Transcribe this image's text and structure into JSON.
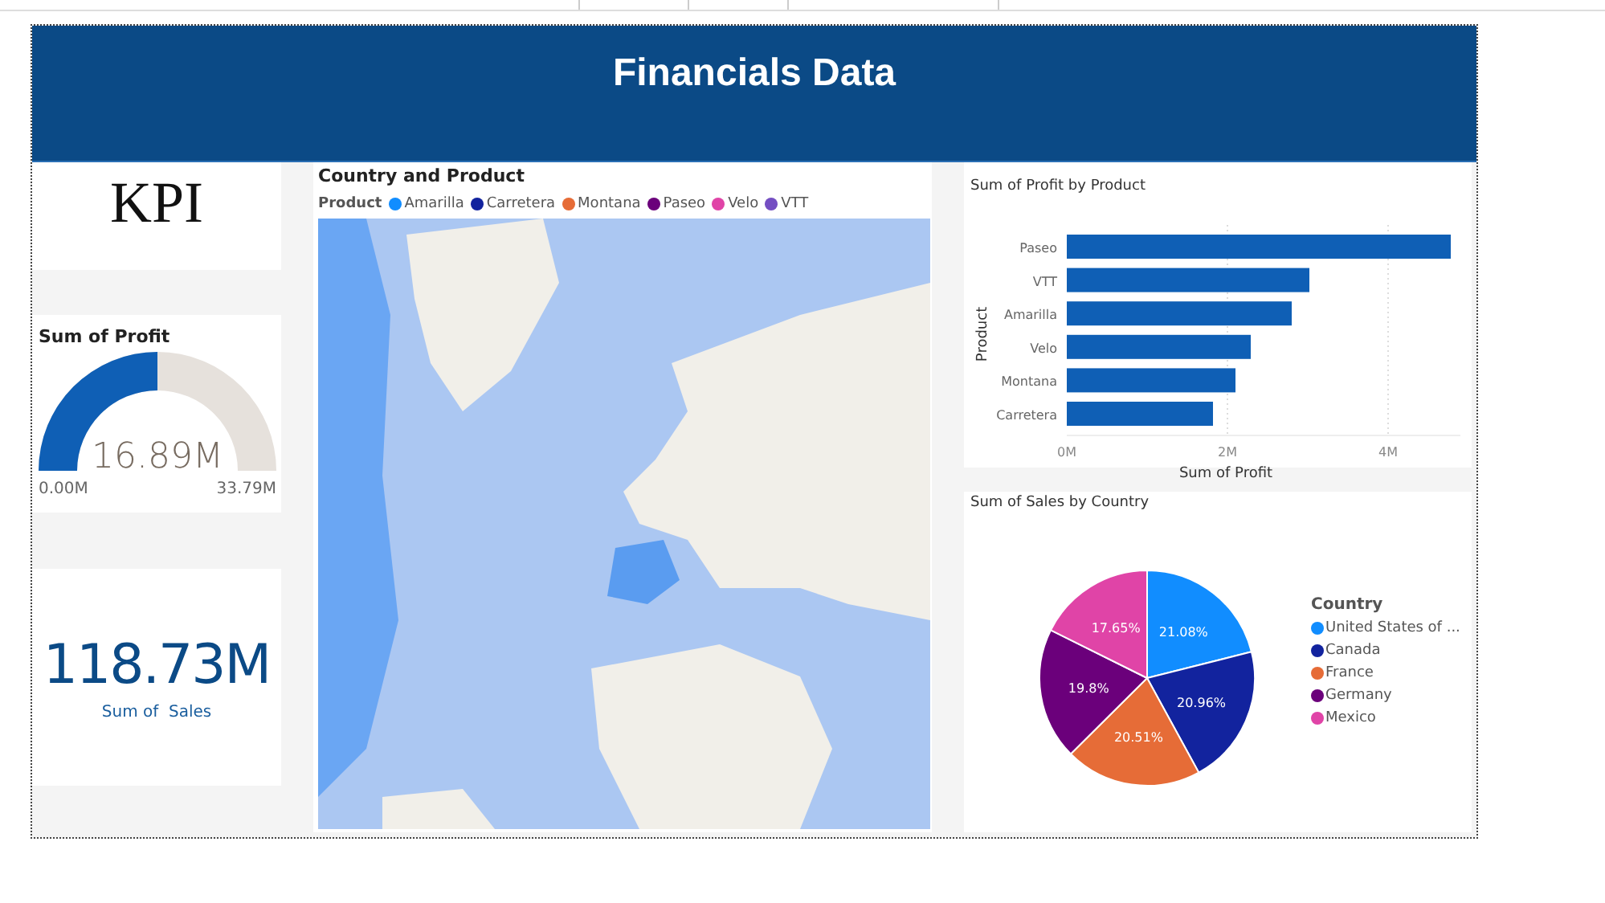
{
  "report": {
    "title": "Financials Data"
  },
  "kpi_card": {
    "text": "KPI"
  },
  "profit_gauge": {
    "title": "Sum of Profit",
    "value": "16.89M",
    "min": "0.00M",
    "max": "33.79M",
    "level": 0.5
  },
  "sales_card": {
    "value": "118.73M",
    "label": "Sum of  Sales"
  },
  "map_visual": {
    "title": "Country and Product",
    "legend_title": "Product",
    "legend": [
      {
        "label": "Amarilla",
        "color": "#118dff"
      },
      {
        "label": "Carretera",
        "color": "#12239e"
      },
      {
        "label": "Montana",
        "color": "#e66c37"
      },
      {
        "label": "Paseo",
        "color": "#6b007b"
      },
      {
        "label": "Velo",
        "color": "#e044a7"
      },
      {
        "label": "VTT",
        "color": "#744ec2"
      }
    ]
  },
  "profit_by_product": {
    "title": "Sum of Profit by Product",
    "chart_data": {
      "type": "bar",
      "orientation": "horizontal",
      "xlabel": "Sum of Profit",
      "ylabel": "Product",
      "categories": [
        "Paseo",
        "VTT",
        "Amarilla",
        "Velo",
        "Montana",
        "Carretera"
      ],
      "values": [
        4.78,
        3.02,
        2.8,
        2.29,
        2.1,
        1.82
      ],
      "xlim": [
        0,
        4.9
      ],
      "xticks": [
        {
          "value": 0,
          "label": "0M"
        },
        {
          "value": 2,
          "label": "2M"
        },
        {
          "value": 4,
          "label": "4M"
        }
      ]
    }
  },
  "sales_by_country": {
    "title": "Sum of Sales by Country",
    "legend_title": "Country",
    "chart_data": {
      "type": "pie",
      "categories": [
        "United States of ...",
        "Canada",
        "France",
        "Germany",
        "Mexico"
      ],
      "values": [
        21.08,
        20.96,
        20.51,
        19.8,
        17.65
      ],
      "colors": [
        "#118dff",
        "#12239e",
        "#e66c37",
        "#6b007b",
        "#e044a7"
      ],
      "value_labels": [
        "21.08%",
        "20.96%",
        "20.51%",
        "19.8%",
        "17.65%"
      ]
    }
  }
}
